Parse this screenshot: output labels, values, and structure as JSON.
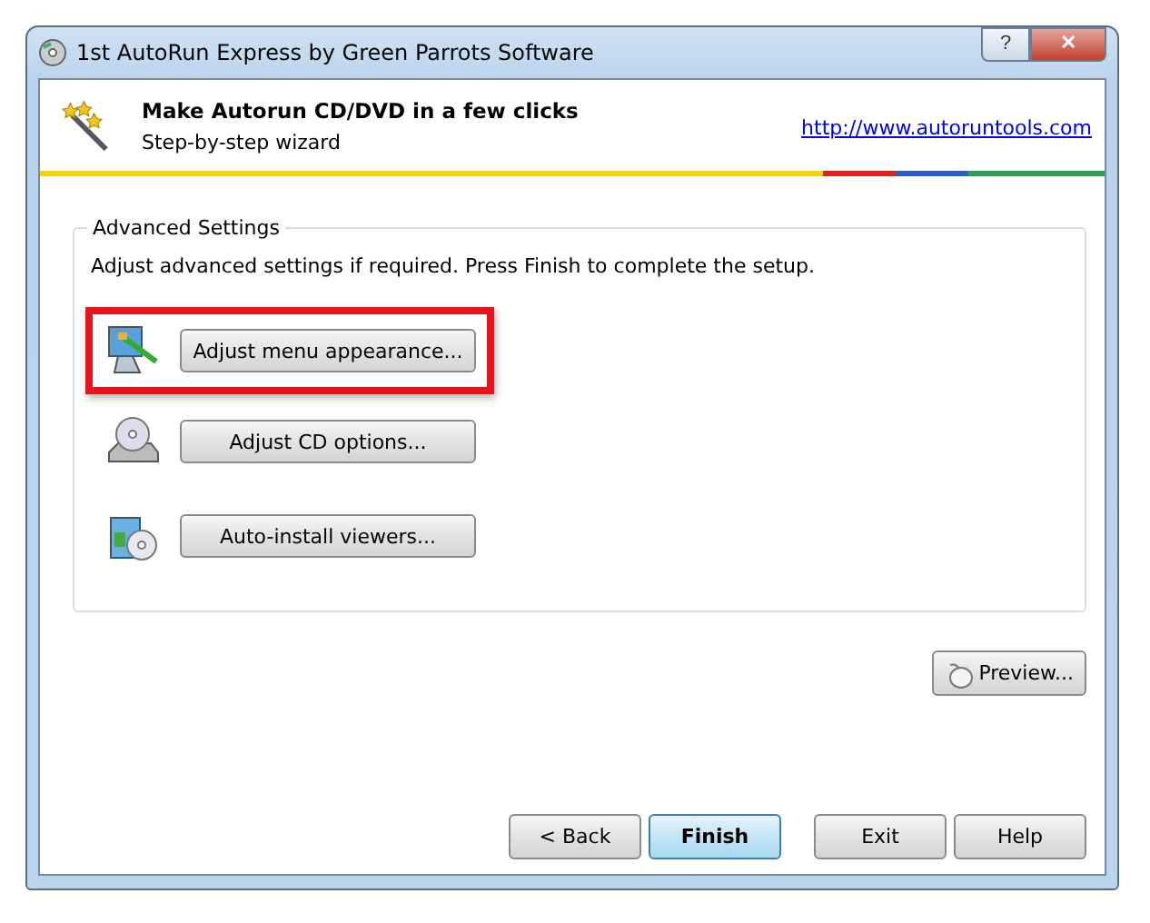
{
  "window": {
    "title": "1st AutoRun Express by Green Parrots Software",
    "controls": [
      {
        "kind": "help",
        "label": "?"
      },
      {
        "kind": "close",
        "label": "✕"
      }
    ]
  },
  "header": {
    "title": "Make Autorun CD/DVD in a few clicks",
    "subtitle": "Step-by-step wizard",
    "link": "http://www.autoruntools.com"
  },
  "group": {
    "title": "Advanced Settings",
    "description": "Adjust advanced settings if required. Press Finish to complete the setup.",
    "actions": [
      {
        "kind": "monitor",
        "label": "Adjust menu appearance...",
        "highlighted": true
      },
      {
        "kind": "drive",
        "label": "Adjust CD options...",
        "highlighted": false
      },
      {
        "kind": "box",
        "label": "Auto-install viewers...",
        "highlighted": false
      }
    ]
  },
  "preview_button": {
    "label": "Preview..."
  },
  "button_groups": [
    {
      "buttons": [
        {
          "label": "< Back",
          "default": false
        },
        {
          "label": "Finish",
          "default": true
        }
      ]
    },
    {
      "buttons": [
        {
          "label": "Exit",
          "default": false
        },
        {
          "label": "Help",
          "default": false
        }
      ]
    }
  ]
}
